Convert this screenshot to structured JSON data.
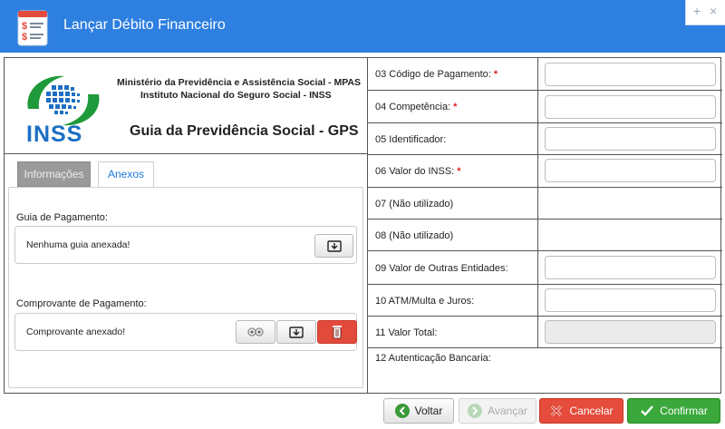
{
  "window": {
    "title": "Lançar Débito Financeiro",
    "controls": [
      "+",
      "×"
    ]
  },
  "header": {
    "logo_text": "INSS",
    "org_line1": "Ministério da Previdência e Assistência Social - MPAS",
    "org_line2": "Instituto Nacional do Seguro Social - INSS",
    "form_title": "Guia da Previdência Social - GPS"
  },
  "tabs": [
    {
      "label": "Informações",
      "active": false
    },
    {
      "label": "Anexos",
      "active": true
    }
  ],
  "anexos": {
    "guia_label": "Guia de Pagamento:",
    "guia_status": "Nenhuma guia anexada!",
    "comprovante_label": "Comprovante de Pagamento:",
    "comprovante_status": "Comprovante anexado!"
  },
  "fields": [
    {
      "label": "03 Código de Pagamento:",
      "required": "*",
      "value": ""
    },
    {
      "label": "04 Competência:",
      "required": "*",
      "value": ""
    },
    {
      "label": "05 Identificador:",
      "required": "",
      "value": ""
    },
    {
      "label": "06 Valor do INSS:",
      "required": "*",
      "value": ""
    },
    {
      "label": "07 (Não utilizado)",
      "required": ""
    },
    {
      "label": "08 (Não utilizado)",
      "required": ""
    },
    {
      "label": "09 Valor de Outras Entidades:",
      "required": "",
      "value": ""
    },
    {
      "label": "10 ATM/Multa e Juros:",
      "required": "",
      "value": ""
    },
    {
      "label": "11 Valor Total:",
      "required": "",
      "value": ""
    },
    {
      "label": "12 Autenticação Bancaria:",
      "required": ""
    }
  ],
  "buttons": {
    "voltar": "Voltar",
    "avancar": "Avançar",
    "cancelar": "Cancelar",
    "confirmar": "Confirmar"
  },
  "colors": {
    "titlebar": "#2d7fe0",
    "required": "#e02020",
    "cancel": "#e54c3c",
    "confirm": "#3aa83a",
    "inss_green": "#1f9a3a",
    "inss_blue": "#1c6fc4"
  }
}
